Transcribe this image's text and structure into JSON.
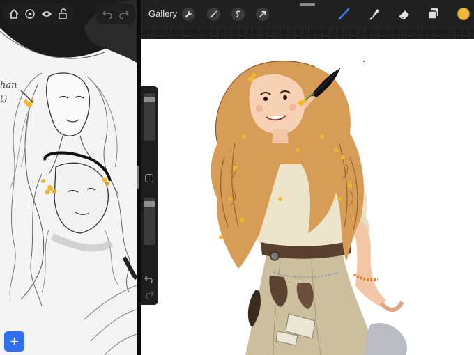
{
  "left_pane": {
    "toolbar_icons": [
      "home-icon",
      "play-icon",
      "eye-icon",
      "lock-open-icon"
    ],
    "undo_icons": [
      "undo-icon",
      "redo-icon"
    ],
    "add_button_label": "+",
    "sketch_note": "han\nt)"
  },
  "procreate": {
    "gallery_label": "Gallery",
    "left_tools": [
      "wrench-icon",
      "magic-wand-icon",
      "selection-icon",
      "transform-arrow-icon"
    ],
    "right_tools": [
      "brush-icon",
      "smudge-icon",
      "eraser-icon",
      "layers-icon"
    ],
    "active_tool": "brush-icon",
    "colors": {
      "accent": "#3b82f6",
      "current_color": "#f0b93a",
      "toolbar_bg": "#202020"
    },
    "sidebar": {
      "size_level": 0.95,
      "opacity_level": 0.95,
      "controls": [
        "modify-button",
        "undo-icon",
        "redo-icon"
      ]
    }
  }
}
